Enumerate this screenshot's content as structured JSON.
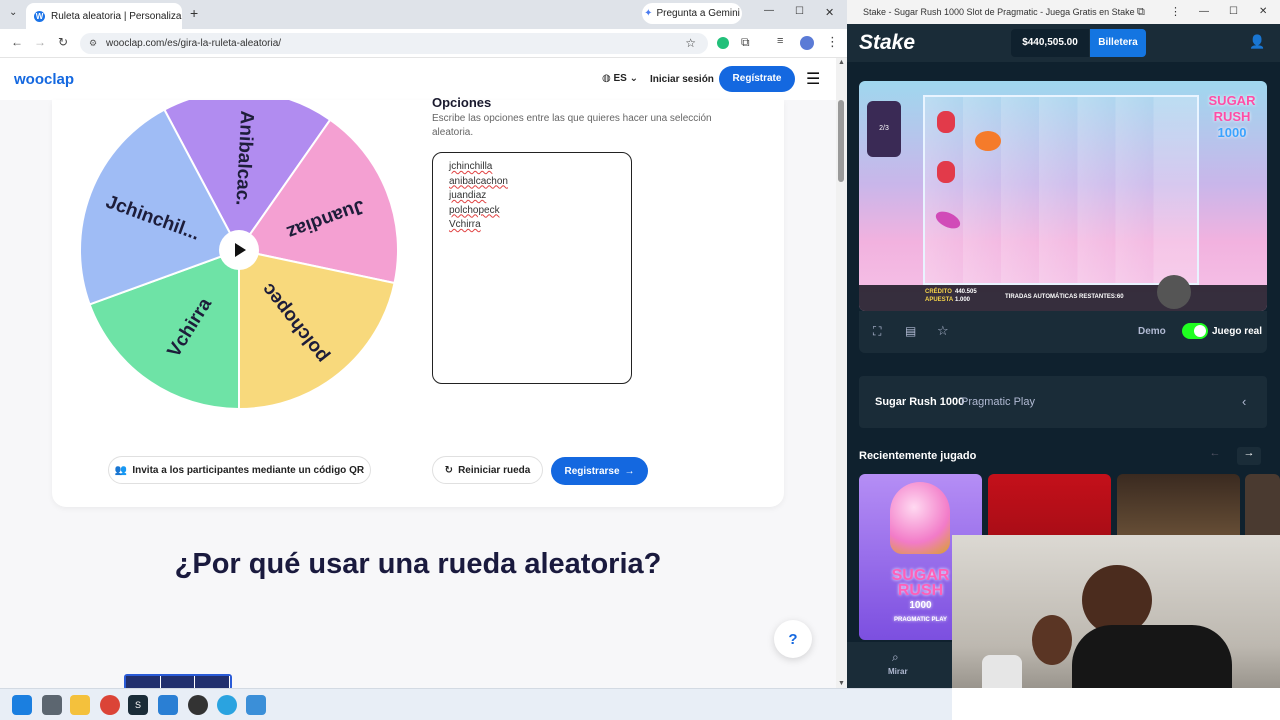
{
  "browser": {
    "tab_title": "Ruleta aleatoria | Personaliza y",
    "gemini_label": "Pregunta a Gemini",
    "url": "wooclap.com/es/gira-la-ruleta-aleatoria/"
  },
  "site": {
    "logo": "wooclap",
    "lang": "ES",
    "login": "Iniciar sesión",
    "signup": "Regístrate"
  },
  "wheel": {
    "segments": [
      {
        "label": "Anibalcac.",
        "color": "#b18cf0"
      },
      {
        "label": "Juandiaz",
        "color": "#f4a0d2"
      },
      {
        "label": "polchopec",
        "color": "#f8d97c"
      },
      {
        "label": "Vchirra",
        "color": "#6ee3a6"
      },
      {
        "label": "Jchinchil...",
        "color": "#9fbcf5"
      }
    ]
  },
  "options": {
    "title": "Opciones",
    "description": "Escribe las opciones entre las que quieres hacer una selección aleatoria.",
    "items": [
      "jchinchilla",
      "anibalcachon",
      "juandiaz",
      "polchopeck",
      "Vchirra"
    ]
  },
  "actions": {
    "invite": "Invita a los participantes mediante un código QR",
    "reset": "Reiniciar rueda",
    "register": "Registrarse"
  },
  "section_title": "¿Por qué usar una rueda aleatoria?",
  "help": "?",
  "stake": {
    "window_title": "Stake - Sugar Rush 1000 Slot de Pragmatic - Juega Gratis en Stake",
    "logo": "Stake",
    "balance": "$440,505.00",
    "wallet": "Billetera",
    "game_logo_1": "SUGAR",
    "game_logo_2": "RUSH",
    "game_logo_3": "1000",
    "credit_label": "CRÉDITO",
    "credit": "440.505",
    "bet_label": "APUESTA",
    "bet": "1.000",
    "autospin": "TIRADAS AUTOMÁTICAS RESTANTES:60",
    "counter": "2/3",
    "demo": "Demo",
    "real": "Juego real",
    "game_name": "Sugar Rush 1000",
    "provider": "Pragmatic Play",
    "recent_title": "Recientemente jugado",
    "card1_l1": "SUGAR",
    "card1_l2": "RUSH",
    "card1_l3": "1000",
    "card1_l4": "PRAGMATIC PLAY",
    "bottom_nav": "Mirar"
  }
}
